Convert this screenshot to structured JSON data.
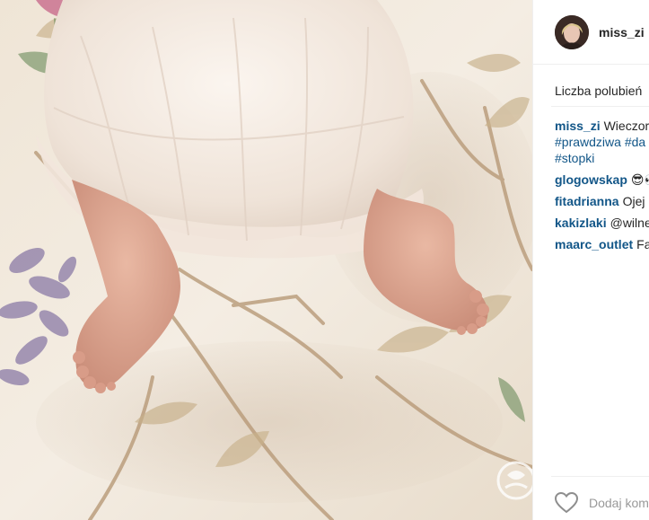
{
  "post": {
    "username": "miss_zi",
    "likes_label": "Liczba polubień",
    "caption": {
      "user": "miss_zi",
      "text": "Wieczor",
      "hashtags": [
        "#prawdziwa #da",
        "#stopki"
      ]
    },
    "comments": [
      {
        "user": "glogowskap",
        "text": "😎👀"
      },
      {
        "user": "fitadrianna",
        "text": "Ojej"
      },
      {
        "user": "kakizlaki",
        "text": "@wilne"
      },
      {
        "user": "maarc_outlet",
        "text": "Fa"
      }
    ],
    "add_comment_placeholder": "Dodaj kom"
  },
  "icons": {
    "avatar": "profile-photo",
    "heart": "heart-outline-icon",
    "watermark": "watermark-logo"
  },
  "colors": {
    "username": "#262626",
    "link": "#125688",
    "placeholder": "#999999",
    "divider": "#efefef"
  }
}
